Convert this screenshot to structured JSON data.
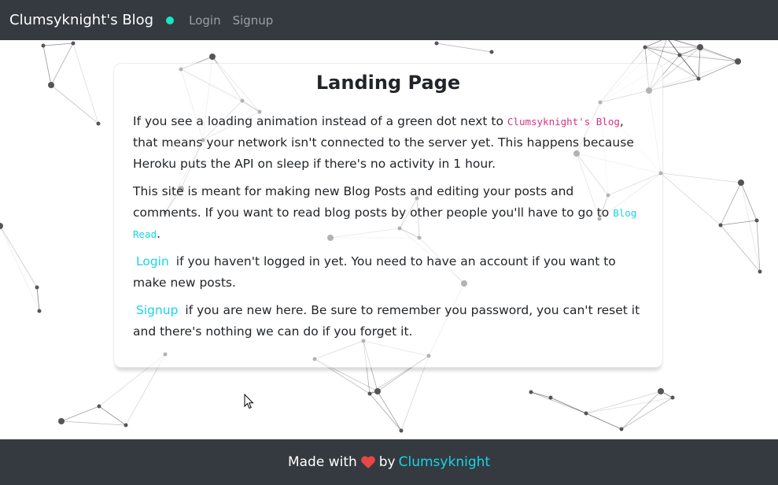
{
  "navbar": {
    "brand": "Clumsyknight's Blog",
    "status_color": "#17e6c2",
    "links": [
      "Login",
      "Signup"
    ]
  },
  "card": {
    "title": "Landing Page",
    "p1": {
      "before": "If you see a loading animation instead of a green dot next to",
      "code": "Clumsyknight's Blog",
      "after": ", that means your network isn't connected to the server yet. This happens because Heroku puts the API on sleep if there's no activity in 1 hour."
    },
    "p2": {
      "before": "This site is meant for making new Blog Posts and editing your posts and comments. If you want to read blog posts by other people you'll have to go to",
      "code": "Blog Read",
      "after": "."
    },
    "p3": {
      "link": "Login",
      "after": "if you haven't logged in yet. You need to have an account if you want to make new posts."
    },
    "p4": {
      "link": "Signup",
      "after": "if you are new here. Be sure to remember you password, you can't reset it and there's nothing we can do if you forget it."
    }
  },
  "footer": {
    "made_with": "Made with",
    "by": "by",
    "author": "Clumsyknight",
    "heart_color": "#e84545"
  },
  "colors": {
    "navbar_bg": "#343a40",
    "link": "#17d4e6",
    "code_pink": "#d63384"
  }
}
